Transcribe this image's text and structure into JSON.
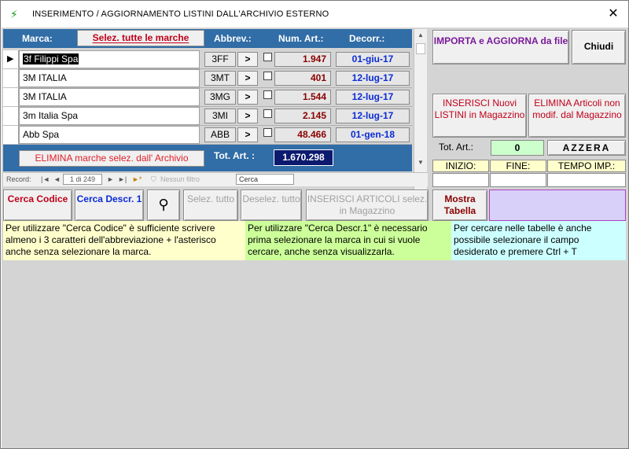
{
  "window": {
    "title": "INSERIMENTO / AGGIORNAMENTO LISTINI DALL'ARCHIVIO ESTERNO",
    "close_glyph": "✕",
    "app_icon": "⚡"
  },
  "grid": {
    "headers": {
      "marca": "Marca:",
      "select_all": "Selez. tutte le marche",
      "abbrev": "Abbrev.:",
      "num_art": "Num. Art.:",
      "decorr": "Decorr.:"
    },
    "go_glyph": ">",
    "rows": [
      {
        "marca": "3f Filippi Spa",
        "abbr": "3FF",
        "num": "1.947",
        "decorr": "01-giu-17",
        "selected": true
      },
      {
        "marca": "3M ITALIA",
        "abbr": "3MT",
        "num": "401",
        "decorr": "12-lug-17",
        "selected": false
      },
      {
        "marca": "3M ITALIA",
        "abbr": "3MG",
        "num": "1.544",
        "decorr": "12-lug-17",
        "selected": false
      },
      {
        "marca": "3m Italia Spa",
        "abbr": "3MI",
        "num": "2.145",
        "decorr": "12-lug-17",
        "selected": false
      },
      {
        "marca": "Abb Spa",
        "abbr": "ABB",
        "num": "48.466",
        "decorr": "01-gen-18",
        "selected": false
      }
    ],
    "elimina_label": "ELIMINA marche selez. dall' Archivio",
    "tot_art_label": "Tot. Art. :",
    "tot_art_value": "1.670.298"
  },
  "navigation": {
    "record_label": "Record:",
    "position": "1 di 249",
    "filter_label": "Nessun filtro",
    "search_placeholder": "Cerca"
  },
  "right_panel": {
    "importa_label": "IMPORTA e AGGIORNA da file",
    "chiudi_label": "Chiudi",
    "inserisci_label": "INSERISCI Nuovi LISTINI in Magazzino",
    "elimina_label": "ELIMINA Articoli non modif. dal Magazzino",
    "tot_art_label": "Tot. Art.:",
    "tot_art_value": "0",
    "azzera_label": "AZZERA",
    "inizio_label": "INIZIO:",
    "fine_label": "FINE:",
    "tempo_label": "TEMPO IMP.:"
  },
  "bottom_buttons": {
    "cerca_codice": "Cerca Codice",
    "cerca_descr": "Cerca Descr. 1",
    "selez_tutto": "Selez. tutto",
    "deselez_tutto": "Deselez. tutto",
    "inserisci_articoli": "INSERISCI ARTICOLI selez. in Magazzino",
    "mostra_tabella": "Mostra Tabella"
  },
  "info": {
    "left": "Per utilizzare \"Cerca Codice\" è sufficiente scrivere almeno i 3 caratteri dell'abbreviazione + l'asterisco anche senza selezionare la marca.",
    "middle": "Per utilizzare \"Cerca Descr.1\" è necessario prima selezionare la marca in cui si vuole cercare, anche senza visualizzarla.",
    "right": "Per cercare nelle tabelle è anche possibile selezionare il campo desiderato e premere Ctrl + T"
  },
  "colors": {
    "header_blue": "#316da6",
    "num_red": "#8b0000",
    "date_blue": "#0a2bd6",
    "elimina_red": "#e0202a",
    "importa_purple": "#7a1a9a",
    "info_yellow": "#ffffcc",
    "info_green": "#ccff99",
    "info_cyan": "#ccffff",
    "lavender": "#d8d0f8"
  }
}
